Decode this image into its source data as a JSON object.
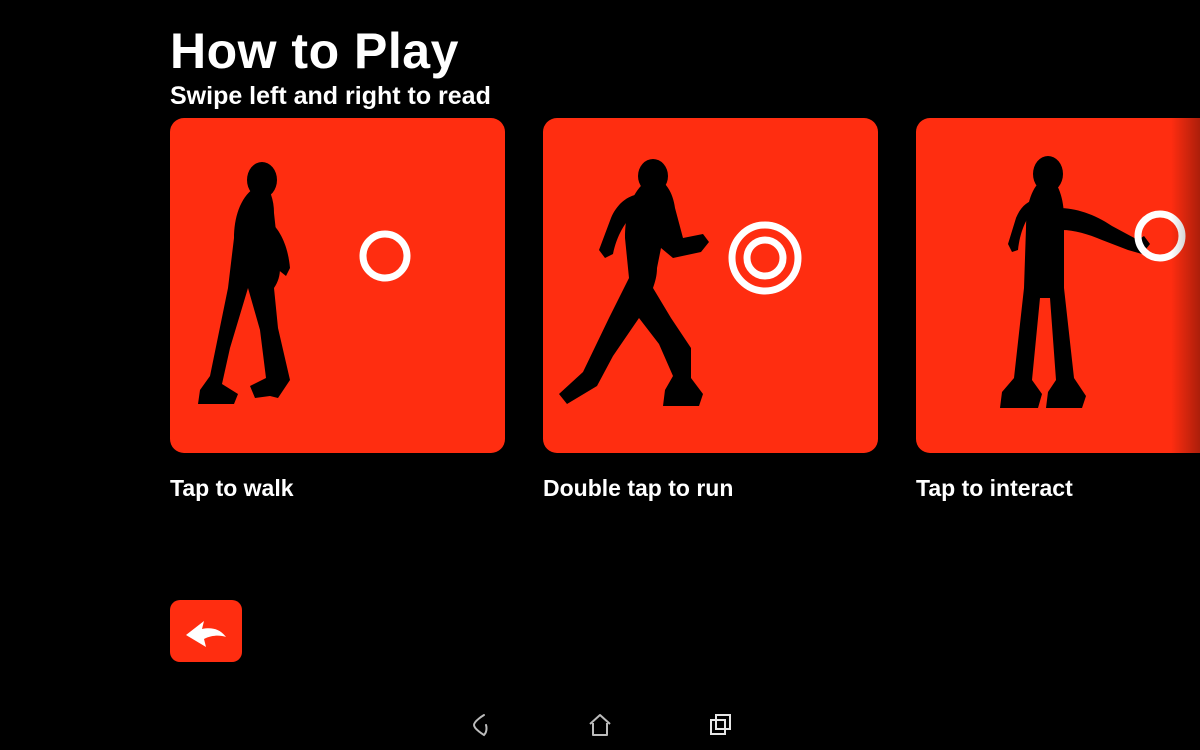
{
  "title": "How to Play",
  "subtitle": "Swipe left and right to read",
  "colors": {
    "accent": "#ff2d10",
    "background": "#000000",
    "text": "#ffffff"
  },
  "cards": [
    {
      "caption": "Tap to walk",
      "pose": "walk",
      "indicator": "single-tap"
    },
    {
      "caption": "Double tap to run",
      "pose": "run",
      "indicator": "double-tap"
    },
    {
      "caption": "Tap to interact",
      "pose": "interact",
      "indicator": "single-tap"
    }
  ],
  "back_button": {
    "icon": "back-arrow"
  },
  "android_nav": {
    "items": [
      {
        "icon": "back",
        "active": false
      },
      {
        "icon": "home",
        "active": false
      },
      {
        "icon": "recent",
        "active": true
      }
    ]
  }
}
